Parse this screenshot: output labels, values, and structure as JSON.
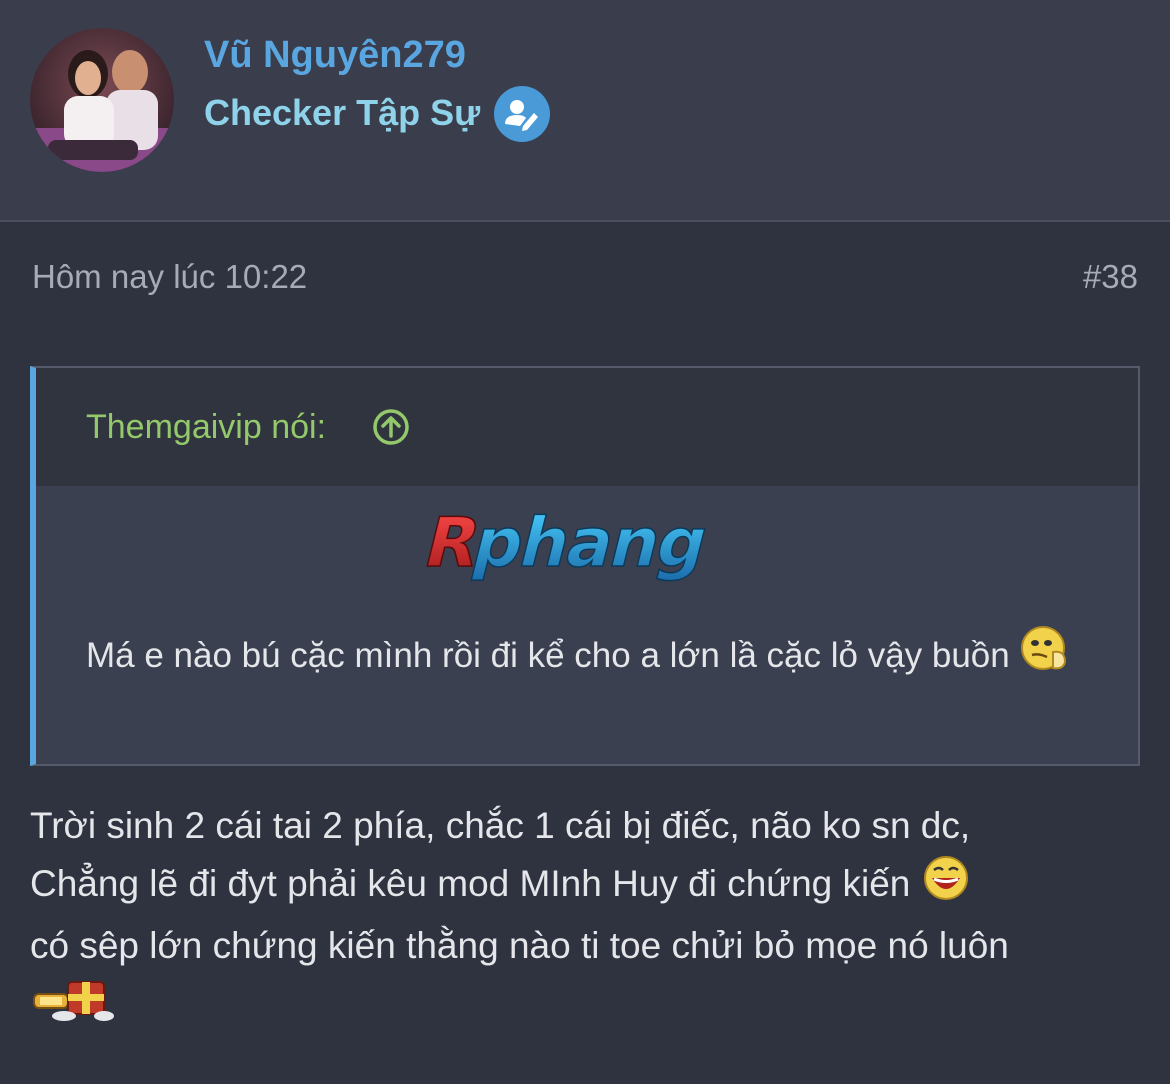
{
  "author": {
    "username": "Vũ Nguyên279",
    "title": "Checker Tập Sự",
    "badge_icon": "user-edit-icon"
  },
  "post": {
    "time": "Hôm nay lúc 10:22",
    "number": "#38"
  },
  "quote": {
    "author_label": "Themgaivip nói:",
    "jump_icon": "arrow-up-circle-icon",
    "logo_text": "Rphang",
    "text": "Má e nào bú cặc mình rồi đi kể cho a lớn lầ cặc lỏ vậy buồn"
  },
  "reply": {
    "line1": "Trời sinh 2 cái tai 2 phía, chắc 1 cái bị điếc, não ko sn dc,",
    "line2": "Chẳng lẽ đi đyt phải kêu mod MInh Huy đi chứng kiến",
    "line3": "có sêp lớn chứng kiến thằng nào ti toe chửi bỏ mọe nó luôn"
  },
  "colors": {
    "background": "#2f3340",
    "header": "#3a3e4c",
    "username": "#5aa6e0",
    "title": "#8fd3ea",
    "quote_author": "#93c96a",
    "quote_border": "#5aa6e0"
  }
}
